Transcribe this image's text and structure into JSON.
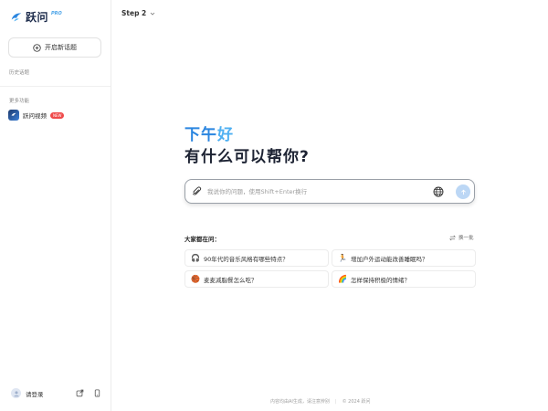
{
  "sidebar": {
    "logo_text": "跃问",
    "logo_badge": "PRO",
    "new_chat_label": "开启新话题",
    "history_label": "历史话题",
    "more_label": "更多功能",
    "video_label": "跃问视频",
    "video_badge": "NEW",
    "login_label": "请登录"
  },
  "header": {
    "step_label": "Step 2"
  },
  "hero": {
    "greeting_prefix": "下午",
    "greeting_highlight": "好",
    "headline": "有什么可以帮你?"
  },
  "search": {
    "placeholder": "我说你的问题，使用Shift+Enter换行"
  },
  "questions": {
    "title": "大家都在问：",
    "refresh_label": "换一批",
    "items": [
      {
        "icon": "headphones-icon",
        "emoji": "🎧",
        "text": "90年代的音乐风格有哪些特点？"
      },
      {
        "icon": "runner-icon",
        "emoji": "🏃",
        "text": "增加户外运动能改善睡眠吗？"
      },
      {
        "icon": "basketball-icon",
        "emoji": "🏀",
        "text": "麦麦减脂餐怎么吃？"
      },
      {
        "icon": "rainbow-icon",
        "emoji": "🌈",
        "text": "怎样保持积极的情绪？"
      }
    ]
  },
  "footer": {
    "disclaimer": "内容均由AI生成，请注意辨别",
    "copyright": "© 2024 跃问"
  },
  "colors": {
    "accent": "#2b86e0",
    "accent_light": "#4fb0f2",
    "send_button": "#bcd7f5",
    "new_badge": "#ef4a4a"
  }
}
